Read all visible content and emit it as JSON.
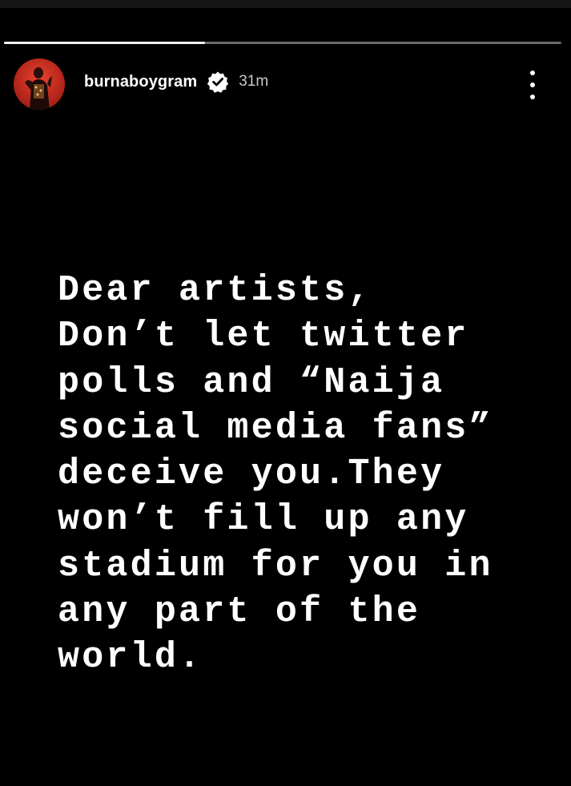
{
  "story": {
    "username": "burnaboygram",
    "time_ago": "31m",
    "progress": 0.36,
    "text_lines": [
      "Dear artists,",
      "Don’t let twitter",
      "polls and “Naija",
      "social media fans”",
      "deceive you.They",
      "won’t fill up any",
      "stadium for you in",
      "any part of the",
      "world."
    ]
  },
  "colors": {
    "background": "#000000",
    "text": "#ffffff",
    "progress_fill": "#f2f2f2",
    "progress_track": "#6a6a6a",
    "avatar_bg": "#c3261c"
  },
  "icons": {
    "verified": "verified-badge-icon",
    "more": "more-vertical-icon"
  }
}
